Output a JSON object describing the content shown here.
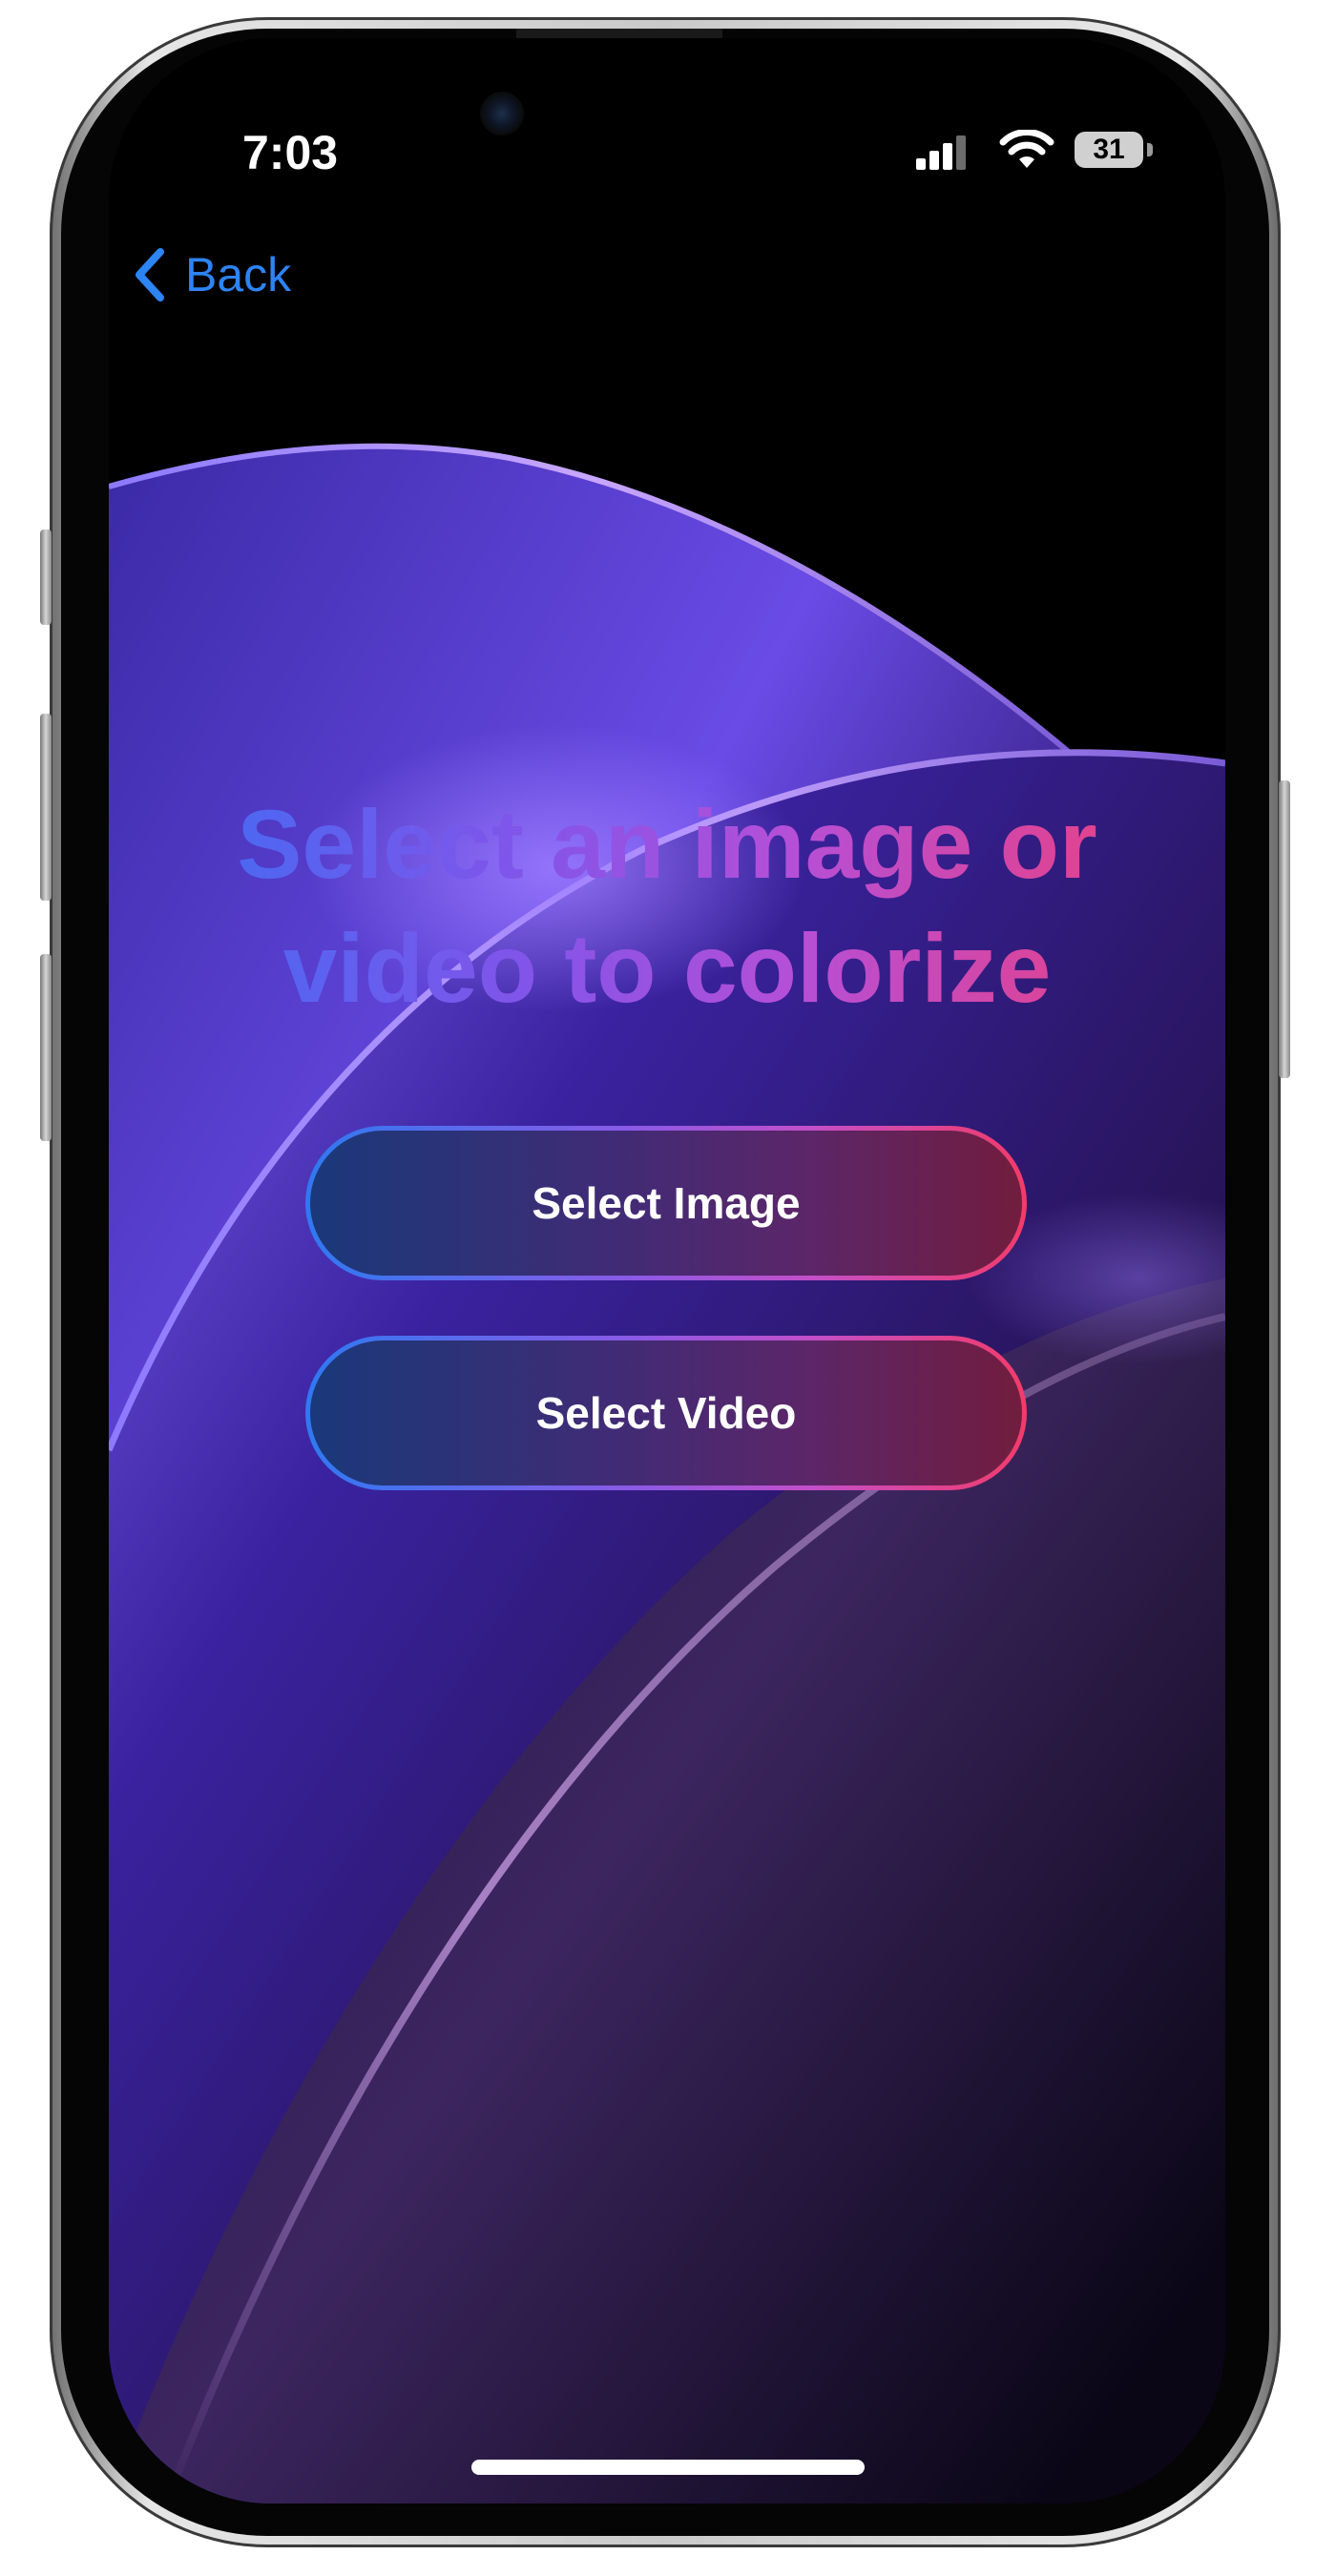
{
  "status_bar": {
    "time": "7:03",
    "battery_level": "31",
    "icons": [
      "cellular-signal-icon",
      "wifi-icon",
      "battery-icon"
    ]
  },
  "nav": {
    "back_label": "Back",
    "back_icon": "chevron-left-icon"
  },
  "main": {
    "headline_line1": "Select an image or",
    "headline_line2": "video to colorize",
    "buttons": [
      {
        "label": "Select Image"
      },
      {
        "label": "Select Video"
      }
    ]
  },
  "colors": {
    "accent_blue": "#2d84f3",
    "gradient_start": "#3d6df4",
    "gradient_mid": "#b54fd7",
    "gradient_end": "#ee3f7b",
    "background": "#000000"
  }
}
